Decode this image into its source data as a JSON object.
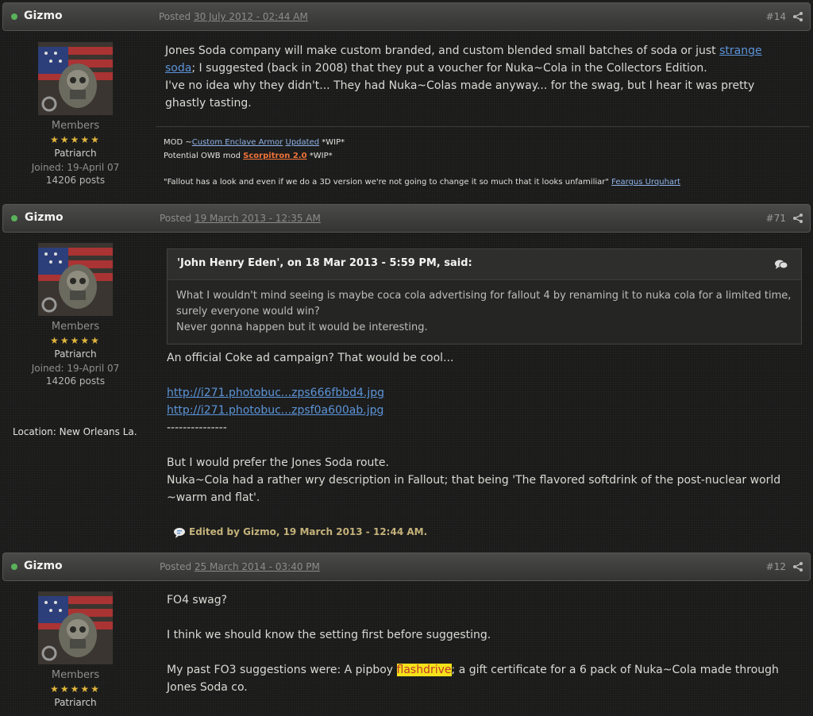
{
  "posts": [
    {
      "author": "Gizmo",
      "posted_prefix": "Posted",
      "date": "30 July 2012 - 02:44 AM",
      "num": "#14",
      "user": {
        "group": "Members",
        "stars": "★★★★★",
        "rank": "Patriarch",
        "joined": "Joined: 19-April 07",
        "posts": "14206 posts"
      },
      "body": {
        "p1_a": "Jones Soda company will make custom branded, and custom blended small batches of soda or just ",
        "p1_link": "strange soda",
        "p1_b": "; I suggested (back in 2008) that they put a voucher for Nuka~Cola in the Collectors Edition.",
        "p2": "I've no idea why they didn't... They had Nuka~Colas made anyway... for the swag, but I hear it was pretty ghastly tasting."
      },
      "sig": {
        "l1_pre": "MOD ~",
        "l1_link1": "Custom Enclave Armor",
        "l1_link2": "Updated",
        "l1_post": " *WIP*",
        "l2_pre": "Potential OWB mod ",
        "l2_link": "Scorpitron 2.0",
        "l2_post": " *WIP*",
        "quote": "\"Fallout has a look and even if we do a 3D version we're not going to change it so much that it looks unfamiliar\" ",
        "quote_author": "Feargus Urquhart"
      }
    },
    {
      "author": "Gizmo",
      "posted_prefix": "Posted",
      "date": "19 March 2013 - 12:35 AM",
      "num": "#71",
      "user": {
        "group": "Members",
        "stars": "★★★★★",
        "rank": "Patriarch",
        "joined": "Joined: 19-April 07",
        "posts": "14206 posts",
        "location": "Location: New Orleans La."
      },
      "quote": {
        "cite": "'John Henry Eden', on 18 Mar 2013 - 5:59 PM, said:",
        "l1": "What I wouldn't mind seeing is maybe coca cola advertising for fallout 4 by renaming it to nuka cola for a limited time, surely everyone would win?",
        "l2": "Never gonna happen but it would be interesting."
      },
      "body": {
        "l1": "An official Coke ad campaign? That would be cool...",
        "link1": "http://i271.photobuc...zps666fbbd4.jpg",
        "link2": "http://i271.photobuc...zpsf0a600ab.jpg",
        "rule": "---------------",
        "l2": "But I would prefer the Jones Soda route.",
        "l3": "Nuka~Cola had a rather wry description in Fallout; that being 'The flavored softdrink of the post-nuclear world ~warm and flat'."
      },
      "edited": "Edited by Gizmo, 19 March 2013 - 12:44 AM."
    },
    {
      "author": "Gizmo",
      "posted_prefix": "Posted",
      "date": "25 March 2014 - 03:40 PM",
      "num": "#12",
      "user": {
        "group": "Members",
        "stars": "★★★★★",
        "rank": "Patriarch"
      },
      "body": {
        "l1": "FO4 swag?",
        "l2": "I think we should know the setting first before suggesting.",
        "l3_a": "My past FO3 suggestions were: A pipboy ",
        "l3_hl": "flashdrive",
        "l3_b": "; a gift certificate for a 6 pack of Nuka~Cola made through Jones Soda co."
      }
    }
  ],
  "colors": {
    "online": "#5ab25a",
    "link": "#5b94d8",
    "star": "#e2b63c",
    "highlight": "#f5e21a"
  }
}
